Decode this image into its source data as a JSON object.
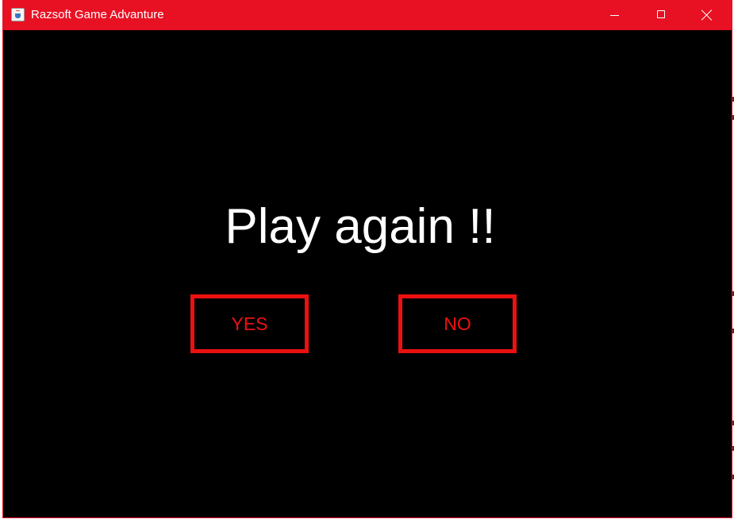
{
  "window": {
    "title": "Razsoft Game Advanture",
    "icon": "java-cup-icon",
    "controls": [
      "minimize-icon",
      "maximize-icon",
      "close-icon"
    ],
    "titlebar_color": "#e81123"
  },
  "game": {
    "prompt": "Play again !!",
    "yes_label": "YES",
    "no_label": "NO",
    "background_color": "#000000",
    "text_color": "#ffffff",
    "button_color": "#ec1111"
  }
}
